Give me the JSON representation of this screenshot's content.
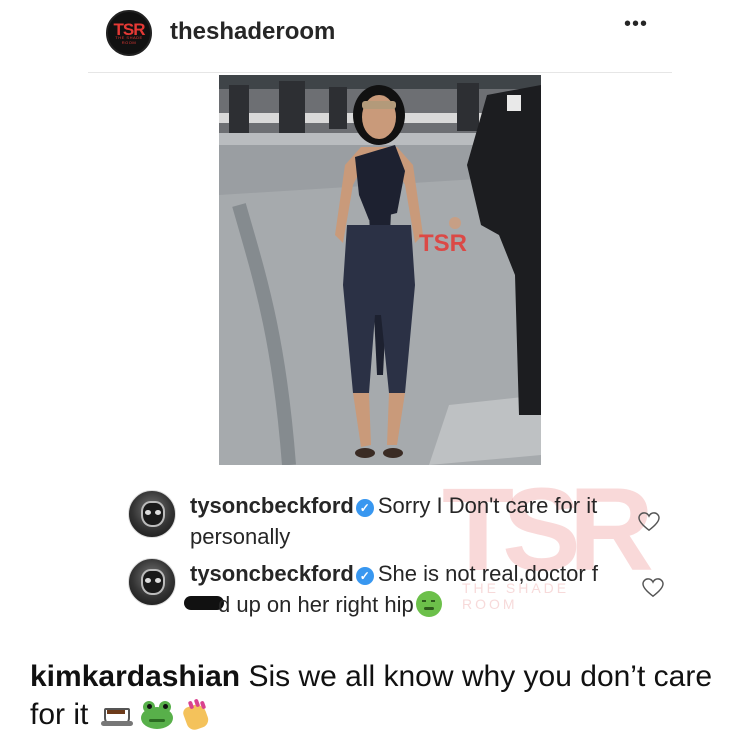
{
  "header": {
    "avatar_text": "TSR",
    "avatar_subtext": "THE SHADE ROOM",
    "username": "theshaderoom",
    "more_label": "•••"
  },
  "photo": {
    "watermark_text": "TSR",
    "description_icon": "photo"
  },
  "comments": [
    {
      "username": "tysoncbeckford",
      "verified": true,
      "text": "Sorry I Don't care for it personally"
    },
    {
      "username": "tysoncbeckford",
      "verified": true,
      "text_before": "She is not real,doctor f",
      "text_after": "d up on her right hip",
      "emoji": "nauseated-face"
    }
  ],
  "watermark": {
    "text": "TSR",
    "subtext": "THE SHADE ROOM"
  },
  "caption": {
    "username": "kimkardashian",
    "text": "Sis we all know why you don’t care for it",
    "emojis": [
      "hot-beverage",
      "frog",
      "nail-polish"
    ]
  },
  "colors": {
    "verified": "#3897f0",
    "brand_red": "#e53935",
    "text": "#262626"
  }
}
